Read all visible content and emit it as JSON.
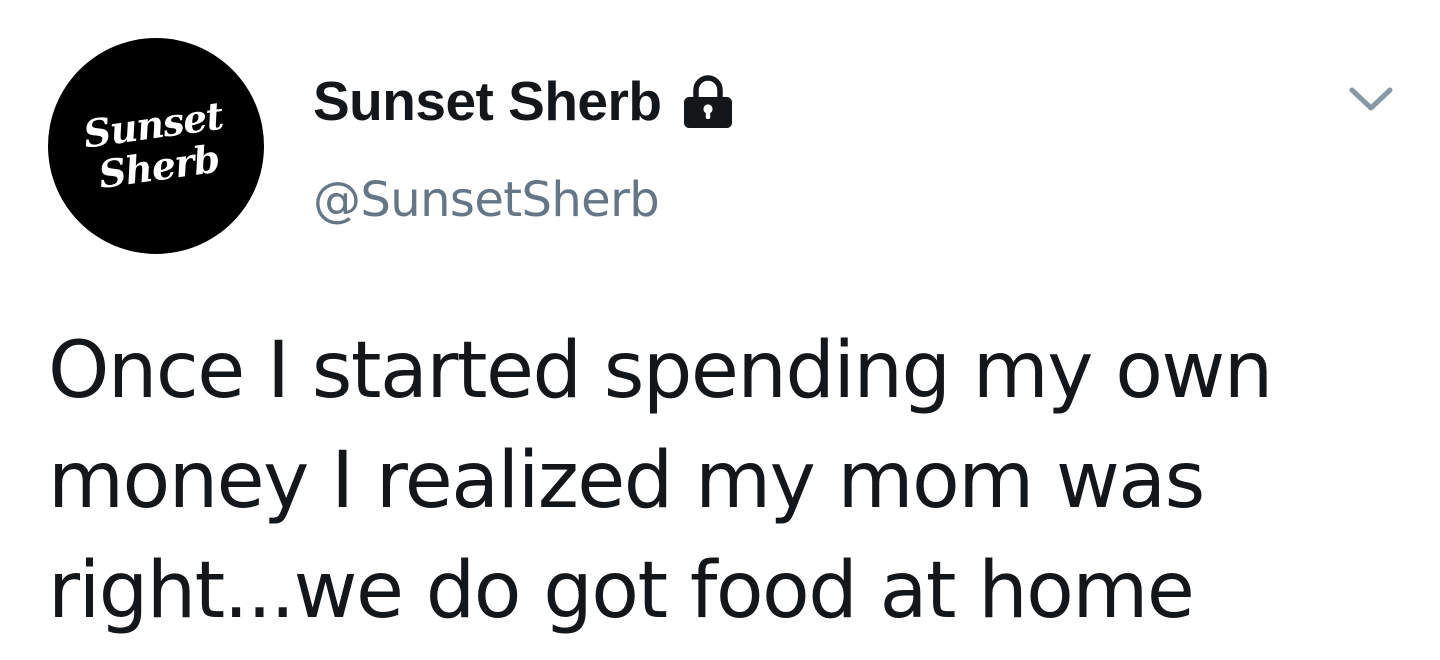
{
  "author": {
    "avatar_logo_text": [
      "Sunset",
      "Sherb"
    ],
    "display_name": "Sunset Sherb",
    "handle": "@SunsetSherb",
    "protected_icon": "lock-icon"
  },
  "menu": {
    "icon": "chevron-down-icon"
  },
  "tweet": {
    "lines": [
      "Once I started spending my own",
      "money I realized my mom was",
      "right...we do got food at home"
    ]
  },
  "colors": {
    "text_primary": "#14171a",
    "text_secondary": "#657786",
    "avatar_bg": "#000000",
    "caret": "#8899a6",
    "background": "#ffffff"
  }
}
